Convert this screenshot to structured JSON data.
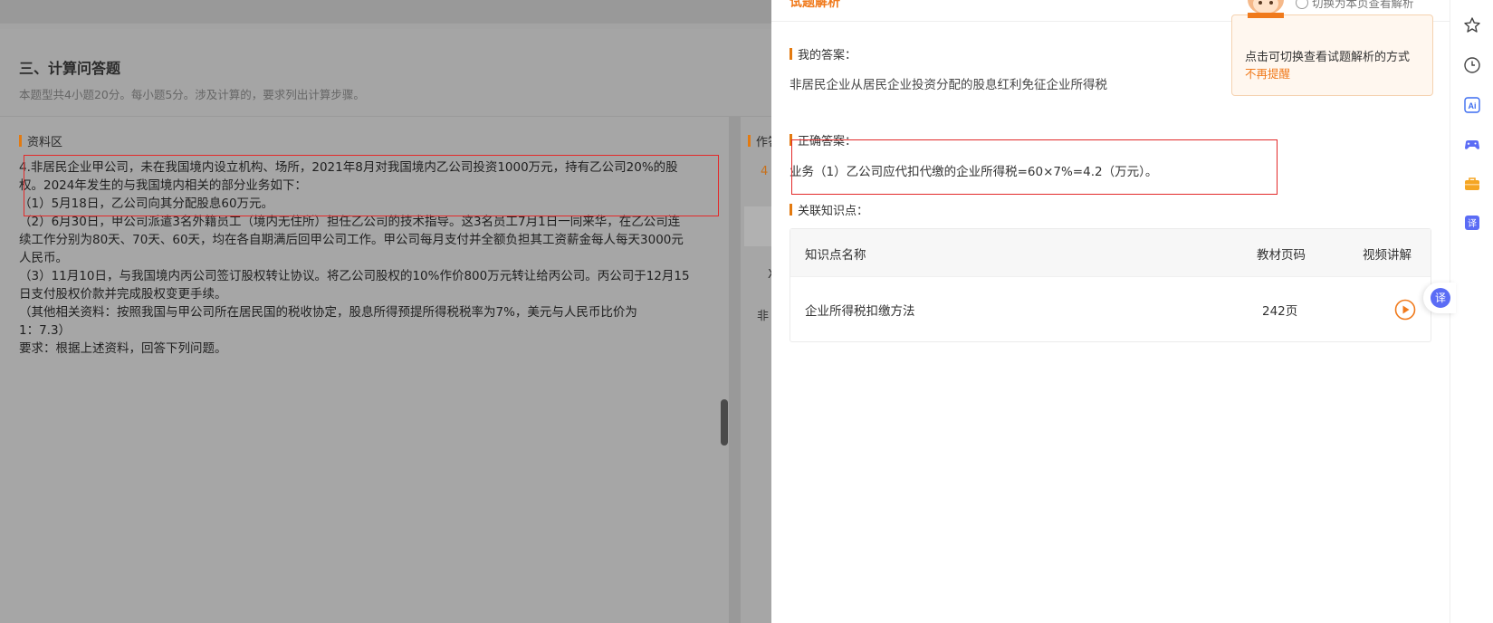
{
  "background": {
    "section_title": "三、计算问答题",
    "section_desc": "本题型共4小题20分。每小题5分。涉及计算的，要求列出计算步骤。",
    "material_label": "资料区",
    "material_lines": [
      "4.非居民企业甲公司，未在我国境内设立机构、场所，2021年8月对我国境内乙公司投资1000万元，持有乙公司20%的股",
      "权。2024年发生的与我国境内相关的部分业务如下：",
      "（1）5月18日，乙公司向其分配股息60万元。",
      "（2）6月30日，甲公司派遣3名外籍员工（境内无住所）担任乙公司的技术指导。这3名员工7月1日一同来华，在乙公司连",
      "续工作分别为80天、70天、60天，均在各自期满后回甲公司工作。甲公司每月支付并全额负担其工资薪金每人每天3000元",
      "人民币。",
      "（3）11月10日，与我国境内丙公司签订股权转让协议。将乙公司股权的10%作价800万元转让给丙公司。丙公司于12月15",
      "日支付股权价款并完成股权变更手续。",
      "（其他相关资料：按照我国与甲公司所在居民国的税收协定，股息所得预提所得税税率为7%，美元与人民币比价为",
      "1：7.3）",
      "要求：根据上述资料，回答下列问题。"
    ],
    "peek_label": "作答",
    "peek_orange": "4",
    "peek_paren": "（",
    "peek_x": "X",
    "peek_text": "非"
  },
  "drawer": {
    "title": "试题解析",
    "switch_label": "切换为本页查看解析",
    "my_answer_label": "我的答案：",
    "my_answer_text": "非居民企业从居民企业投资分配的股息红利免征企业所得税",
    "correct_label": "正确答案：",
    "correct_text": "业务（1）乙公司应代扣代缴的企业所得税=60×7%=4.2（万元）。",
    "related_label": "关联知识点：",
    "table": {
      "headers": [
        "知识点名称",
        "教材页码",
        "视频讲解"
      ],
      "rows": [
        {
          "name": "企业所得税扣缴方法",
          "page": "242页",
          "video_icon": "play-circle-icon"
        }
      ]
    },
    "tooltip": {
      "text": "点击可切换查看试题解析的方式",
      "dismiss": "不再提醒"
    }
  },
  "toolbar": {
    "icons": [
      "star-icon",
      "history-icon",
      "ai-icon",
      "gamepad-icon",
      "toolbox-icon",
      "translate-icon"
    ],
    "ai_text": "Ai",
    "translate_text": "译"
  },
  "colors": {
    "accent": "#f07a1c",
    "highlight_box": "#e32a2a",
    "translate_badge": "#5b6cf5"
  }
}
